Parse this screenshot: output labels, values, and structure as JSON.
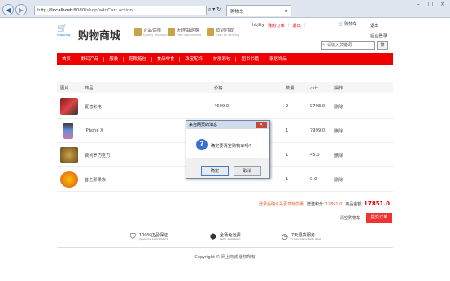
{
  "browser": {
    "url_prefix": "http://",
    "url_host": "localhost",
    "url_rest": ":8080/shop/addCart.action",
    "tab_title": "购物车"
  },
  "header": {
    "logo_sub": "shopping",
    "logo_title": "购物商城",
    "badges": [
      {
        "t1": "正品保障",
        "t2": "Quality assurance"
      },
      {
        "t1": "无理由退换",
        "t2": "Free replacement"
      },
      {
        "t1": "货到付款",
        "t2": "Cash on delivery"
      }
    ],
    "user": "hkitty",
    "my_orders": "我的订单",
    "logout": "退出",
    "cart": "购物车",
    "exit": "退出",
    "back_login": "后台登录",
    "search_placeholder": "请输入关键词",
    "search_btn": "搜"
  },
  "nav": [
    "首页",
    "数码产品",
    "服装",
    "鞋靴箱包",
    "食品零食",
    "珠宝配饰",
    "护肤彩妆",
    "图书书籍",
    "家居饰品"
  ],
  "table": {
    "headers": [
      "图片",
      "商品",
      "价格",
      "数量",
      "小计",
      "操作"
    ],
    "rows": [
      {
        "name": "夏普彩电",
        "price": "4699.0",
        "qty": "2",
        "subtotal": "9798.0",
        "op": "删除"
      },
      {
        "name": "iPhone X",
        "price": "",
        "qty": "1",
        "subtotal": "7999.0",
        "op": "删除"
      },
      {
        "name": "费列罗巧克力",
        "price": "",
        "qty": "1",
        "subtotal": "45.0",
        "op": "删除"
      },
      {
        "name": "昔之那果冻",
        "price": "",
        "qty": "1",
        "subtotal": "9.0",
        "op": "删除"
      }
    ]
  },
  "summary": {
    "note": "登录后确认是否享有优惠",
    "points_label": "赠送积分:",
    "points": "17851.0",
    "total_label": "商品金额:",
    "total": "17851.0"
  },
  "actions": {
    "clear": "清空购物车",
    "submit": "提交订单"
  },
  "footer": {
    "f1": "100%正品保证",
    "f1s": "QUALITY ASSURANCE",
    "f2": "全场免运费",
    "f2s": "FREE SHIPPING",
    "f3": "7天退货服务",
    "f3s": "7-DAY FREE RETURNS",
    "copyright": "Copyright © 网上商城 版权所有"
  },
  "dialog": {
    "title": "来自网页的消息",
    "message": "确定要清空购物车吗?",
    "ok": "确定",
    "cancel": "取消"
  }
}
